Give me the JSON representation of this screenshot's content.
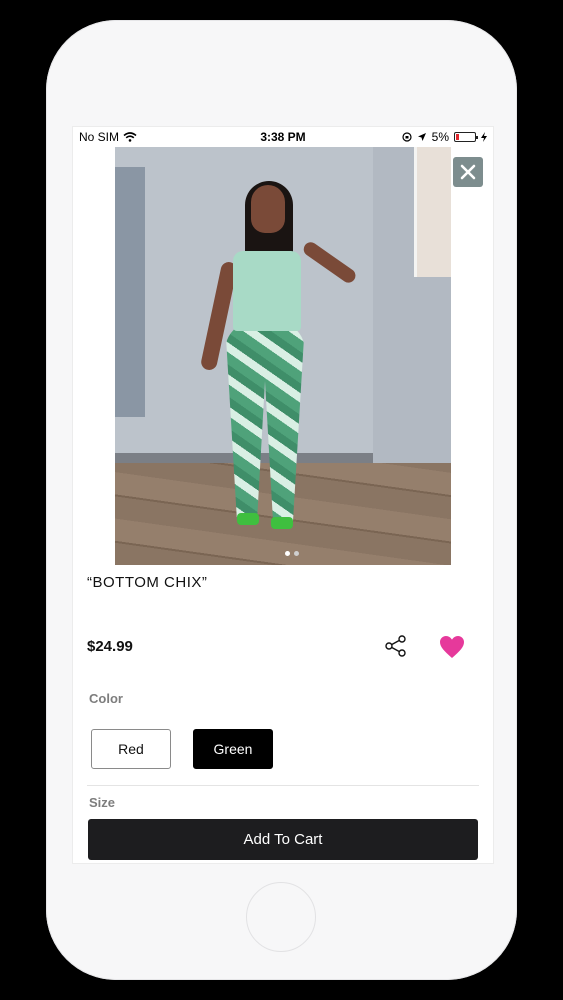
{
  "status_bar": {
    "carrier": "No SIM",
    "time": "3:38 PM",
    "battery_percent": "5%"
  },
  "product": {
    "title": "“BOTTOM CHIX”",
    "price": "$24.99",
    "image_alt": "",
    "image_page_count": 2,
    "image_page_active": 1,
    "favorited": true
  },
  "options": {
    "color_label": "Color",
    "colors": [
      "Red",
      "Green"
    ],
    "selected_color": "Green",
    "size_label": "Size"
  },
  "actions": {
    "add_to_cart": "Add To Cart"
  },
  "icons": {
    "close": "close-icon",
    "share": "share-icon",
    "favorite": "heart-icon",
    "wifi": "wifi-icon",
    "location": "location-arrow-icon",
    "orientation_lock": "orientation-lock-icon",
    "charging": "bolt-icon"
  },
  "colors": {
    "heart": "#e6399b",
    "battery_low": "#e0282e",
    "button_dark": "#1d1d1f",
    "close_bg": "#7d8d8e"
  }
}
